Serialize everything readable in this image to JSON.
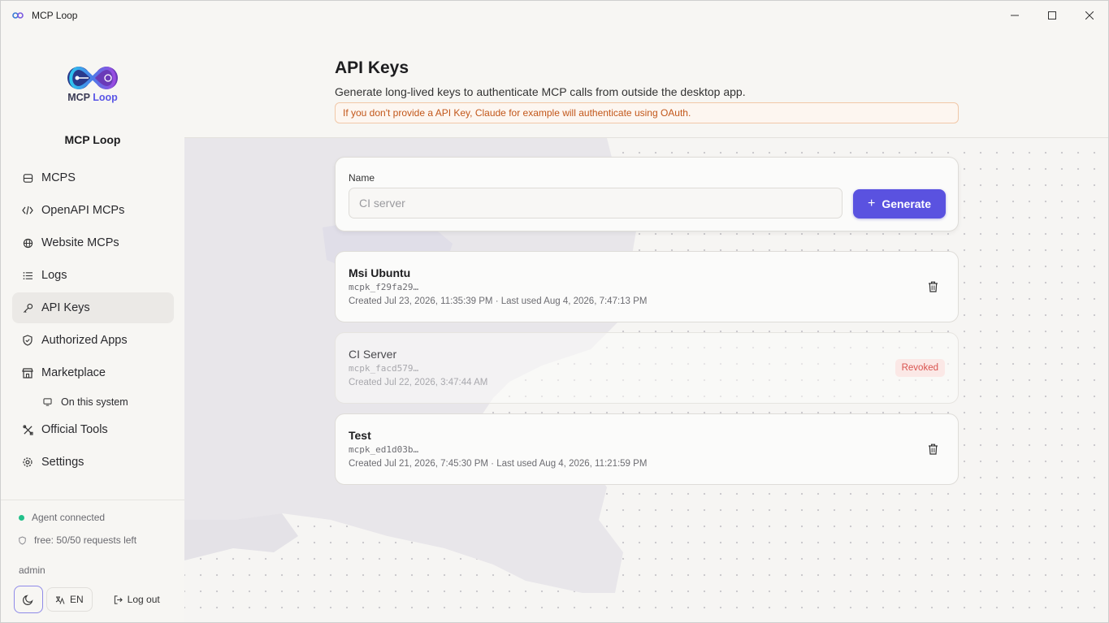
{
  "window": {
    "title": "MCP Loop"
  },
  "sidebar": {
    "logo_text_main": "MCP",
    "logo_text_accent": "Loop",
    "brand_name": "MCP Loop",
    "items": [
      {
        "label": "MCPS",
        "icon": "database-icon"
      },
      {
        "label": "OpenAPI MCPs",
        "icon": "code-icon"
      },
      {
        "label": "Website MCPs",
        "icon": "globe-icon"
      },
      {
        "label": "Logs",
        "icon": "list-icon"
      },
      {
        "label": "API Keys",
        "icon": "key-icon",
        "active": true
      },
      {
        "label": "Authorized Apps",
        "icon": "shield-icon"
      },
      {
        "label": "Marketplace",
        "icon": "store-icon"
      }
    ],
    "sub_item": {
      "label": "On this system",
      "icon": "monitor-icon"
    },
    "items_after": [
      {
        "label": "Official Tools",
        "icon": "tools-icon"
      },
      {
        "label": "Settings",
        "icon": "gear-icon"
      }
    ],
    "status": {
      "agent": "Agent connected",
      "agent_color": "#22c08a",
      "plan": "free: 50/50 requests left"
    },
    "user": "admin",
    "lang": "EN",
    "logout": "Log out"
  },
  "header": {
    "title": "API Keys",
    "subtitle": "Generate long-lived keys to authenticate MCP calls from outside the desktop app.",
    "notice": "If you don't provide a API Key, Claude for example will authenticate using OAuth."
  },
  "generate": {
    "label": "Name",
    "placeholder": "CI server",
    "button": "Generate",
    "accent": "#5a52e0"
  },
  "keys": [
    {
      "name": "Msi Ubuntu",
      "prefix": "mcpk_f29fa29…",
      "meta": "Created Jul 23, 2026, 11:35:39 PM · Last used Aug 4, 2026, 7:47:13 PM",
      "revoked": false
    },
    {
      "name": "CI Server",
      "prefix": "mcpk_facd579…",
      "meta": "Created Jul 22, 2026, 3:47:44 AM",
      "revoked": true,
      "badge": "Revoked"
    },
    {
      "name": "Test",
      "prefix": "mcpk_ed1d03b…",
      "meta": "Created Jul 21, 2026, 7:45:30 PM · Last used Aug 4, 2026, 11:21:59 PM",
      "revoked": false
    }
  ]
}
